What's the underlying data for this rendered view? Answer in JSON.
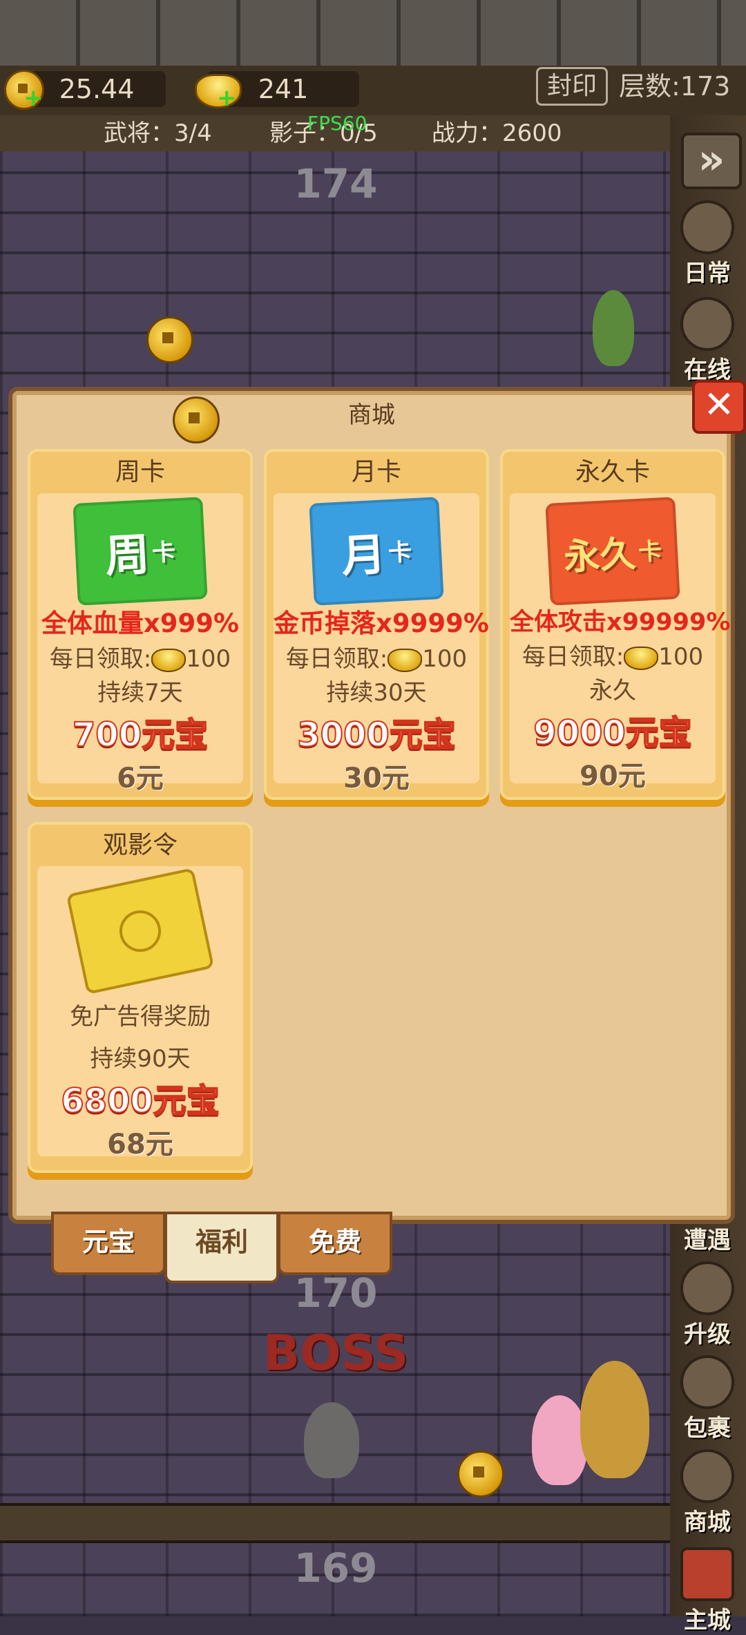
{
  "resources": {
    "coins": "25.44",
    "ingots": "241",
    "plus": "+"
  },
  "seal_button": "封印",
  "floor_label": "层数:173",
  "stats": {
    "generals": "武将：3/4",
    "shadow": "影子：0/5",
    "power": "战力：2600",
    "fps": "FPS60"
  },
  "floors": {
    "top": "174",
    "mid": "170",
    "bottom": "169",
    "boss": "BOSS"
  },
  "sidebar": [
    {
      "label": "日常",
      "icon": "scroll-icon"
    },
    {
      "label": "在线",
      "icon": "clock-icon"
    },
    {
      "label": "遭遇",
      "icon": "encounter-icon"
    },
    {
      "label": "升级",
      "icon": "hero-upgrade-icon"
    },
    {
      "label": "包裹",
      "icon": "bag-icon"
    },
    {
      "label": "商城",
      "icon": "shop-icon"
    },
    {
      "label": "主城",
      "icon": "castle-icon"
    }
  ],
  "fast_forward": "»",
  "modal": {
    "title": "商城",
    "close": "✕",
    "cards": [
      {
        "title": "周卡",
        "card_text": "周",
        "card_sub": "卡",
        "benefit": "全体血量x999%",
        "daily": "每日领取:",
        "daily_amount": "100",
        "duration": "持续7天",
        "price_gold": "700元宝",
        "price_rmb": "6元",
        "color": "#3fbf3a"
      },
      {
        "title": "月卡",
        "card_text": "月",
        "card_sub": "卡",
        "benefit": "金币掉落x9999%",
        "daily": "每日领取:",
        "daily_amount": "100",
        "duration": "持续30天",
        "price_gold": "3000元宝",
        "price_rmb": "30元",
        "color": "#3a9fe0"
      },
      {
        "title": "永久卡",
        "card_text": "永久",
        "card_sub": "卡",
        "benefit": "全体攻击x99999%",
        "daily": "每日领取:",
        "daily_amount": "100",
        "duration": "永久",
        "price_gold": "9000元宝",
        "price_rmb": "90元",
        "color": "#ef5a2e"
      },
      {
        "title": "观影令",
        "benefit": "免广告得奖励",
        "duration": "持续90天",
        "price_gold": "6800元宝",
        "price_rmb": "68元"
      }
    ],
    "tabs": [
      "元宝",
      "福利",
      "免费"
    ]
  }
}
